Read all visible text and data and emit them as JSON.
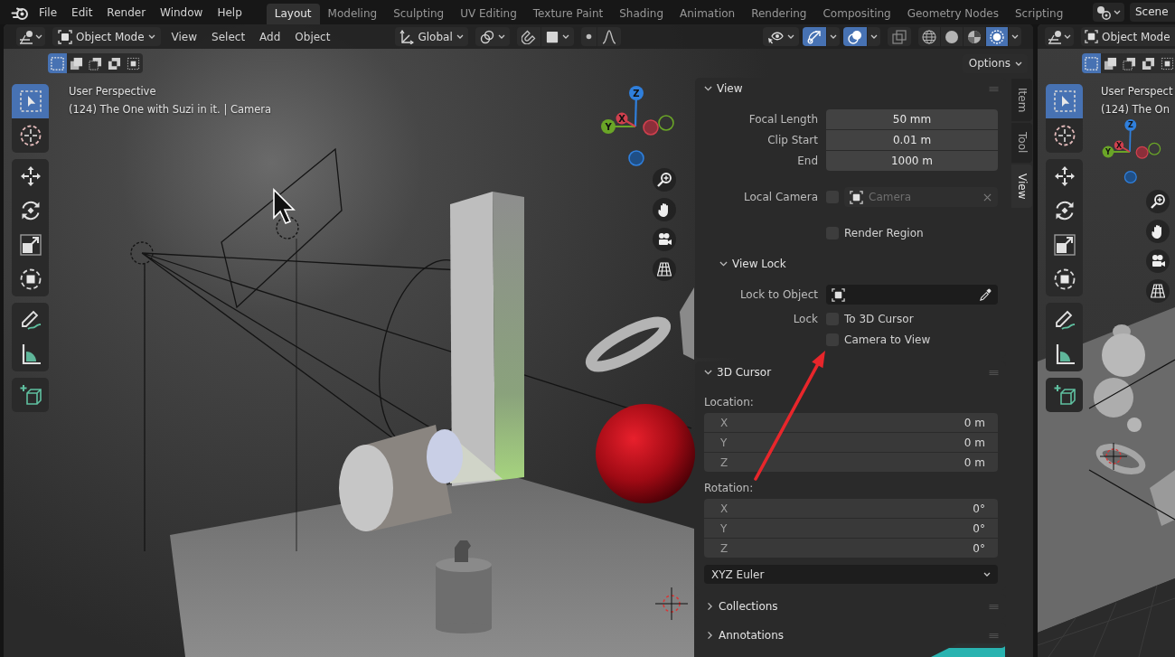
{
  "top_bar": {
    "menus": [
      "File",
      "Edit",
      "Render",
      "Window",
      "Help"
    ],
    "workspaces": [
      {
        "label": "Layout",
        "selected": true
      },
      {
        "label": "Modeling",
        "selected": false
      },
      {
        "label": "Sculpting",
        "selected": false
      },
      {
        "label": "UV Editing",
        "selected": false
      },
      {
        "label": "Texture Paint",
        "selected": false
      },
      {
        "label": "Shading",
        "selected": false
      },
      {
        "label": "Animation",
        "selected": false
      },
      {
        "label": "Rendering",
        "selected": false
      },
      {
        "label": "Compositing",
        "selected": false
      },
      {
        "label": "Geometry Nodes",
        "selected": false
      },
      {
        "label": "Scripting",
        "selected": false
      }
    ],
    "scene": "Scene"
  },
  "viewport": {
    "header": {
      "mode": "Object Mode",
      "menus": [
        "View",
        "Select",
        "Add",
        "Object"
      ],
      "orientation": "Global",
      "toggles": [
        {
          "kind": "gizmos",
          "on": true
        },
        {
          "kind": "overlays",
          "on": true
        },
        {
          "kind": "xray",
          "on": false
        }
      ],
      "shading": [
        {
          "kind": "wireframe",
          "selected": false
        },
        {
          "kind": "solid",
          "selected": false
        },
        {
          "kind": "material",
          "selected": false
        },
        {
          "kind": "rendered",
          "selected": true
        }
      ]
    },
    "select_modes": [
      {
        "kind": "set",
        "selected": true
      },
      {
        "kind": "extend",
        "selected": false
      },
      {
        "kind": "subtract",
        "selected": false
      },
      {
        "kind": "difference",
        "selected": false
      },
      {
        "kind": "intersect",
        "selected": false
      }
    ],
    "options": "Options",
    "info": [
      "User Perspective",
      "(124) The One with Suzi in it. | Camera"
    ],
    "tool_groups": [
      [
        {
          "kind": "select-box",
          "selected": true
        },
        {
          "kind": "cursor",
          "selected": false
        }
      ],
      [
        {
          "kind": "move",
          "selected": false
        },
        {
          "kind": "rotate",
          "selected": false
        },
        {
          "kind": "scale",
          "selected": false
        },
        {
          "kind": "transform",
          "selected": false
        }
      ],
      [
        {
          "kind": "annotate",
          "selected": false
        },
        {
          "kind": "measure",
          "selected": false
        }
      ],
      [
        {
          "kind": "add-cube",
          "selected": false
        }
      ]
    ],
    "gizmo_axes": [
      "Z",
      "Y",
      "X"
    ],
    "navigation": [
      {
        "kind": "zoom"
      },
      {
        "kind": "pan"
      },
      {
        "kind": "camera"
      },
      {
        "kind": "ortho"
      }
    ]
  },
  "sidebar": {
    "tabs": [
      {
        "label": "Item",
        "selected": false
      },
      {
        "label": "Tool",
        "selected": false
      },
      {
        "label": "View",
        "selected": true
      }
    ],
    "view_panel": {
      "title": "View",
      "expanded": true,
      "fields": [
        {
          "label": "Focal Length",
          "value": "50 mm"
        },
        {
          "label": "Clip Start",
          "value": "0.01 m"
        },
        {
          "label": "End",
          "value": "1000 m"
        }
      ],
      "local_camera": {
        "label": "Local Camera",
        "checked": false,
        "value": "Camera",
        "disabled": true
      },
      "render_region": {
        "label": "Render Region",
        "checked": false
      },
      "view_lock": {
        "title": "View Lock",
        "expanded": true,
        "lock_to_object_label": "Lock to Object",
        "lock_label": "Lock",
        "options": [
          {
            "label": "To 3D Cursor",
            "checked": false
          },
          {
            "label": "Camera to View",
            "checked": false
          }
        ]
      }
    },
    "cursor_panel": {
      "title": "3D Cursor",
      "expanded": true,
      "location_label": "Location:",
      "location": [
        {
          "axis": "X",
          "value": "0 m"
        },
        {
          "axis": "Y",
          "value": "0 m"
        },
        {
          "axis": "Z",
          "value": "0 m"
        }
      ],
      "rotation_label": "Rotation:",
      "rotation": [
        {
          "axis": "X",
          "value": "0°"
        },
        {
          "axis": "Y",
          "value": "0°"
        },
        {
          "axis": "Z",
          "value": "0°"
        }
      ],
      "rotation_mode": "XYZ Euler"
    },
    "collapsed_panels": [
      {
        "title": "Collections",
        "expanded": false
      },
      {
        "title": "Annotations",
        "expanded": false
      }
    ]
  },
  "second_viewport": {
    "mode": "Object Mode",
    "select_modes": [
      {
        "kind": "set",
        "selected": true
      },
      {
        "kind": "extend",
        "selected": false
      },
      {
        "kind": "subtract",
        "selected": false
      },
      {
        "kind": "difference",
        "selected": false
      },
      {
        "kind": "intersect",
        "selected": false
      }
    ],
    "info": [
      "User Perspect",
      "(124) The On"
    ],
    "tool_groups": [
      [
        {
          "kind": "select-box",
          "selected": true
        },
        {
          "kind": "cursor",
          "selected": false
        }
      ],
      [
        {
          "kind": "move",
          "selected": false
        },
        {
          "kind": "rotate",
          "selected": false
        },
        {
          "kind": "scale",
          "selected": false
        },
        {
          "kind": "transform",
          "selected": false
        }
      ],
      [
        {
          "kind": "annotate",
          "selected": false
        },
        {
          "kind": "measure",
          "selected": false
        }
      ],
      [
        {
          "kind": "add-cube",
          "selected": false
        }
      ]
    ],
    "gizmo_axes": [
      "Z",
      "Y",
      "X"
    ],
    "navigation": [
      {
        "kind": "zoom"
      },
      {
        "kind": "pan"
      },
      {
        "kind": "camera"
      },
      {
        "kind": "ortho"
      }
    ]
  }
}
